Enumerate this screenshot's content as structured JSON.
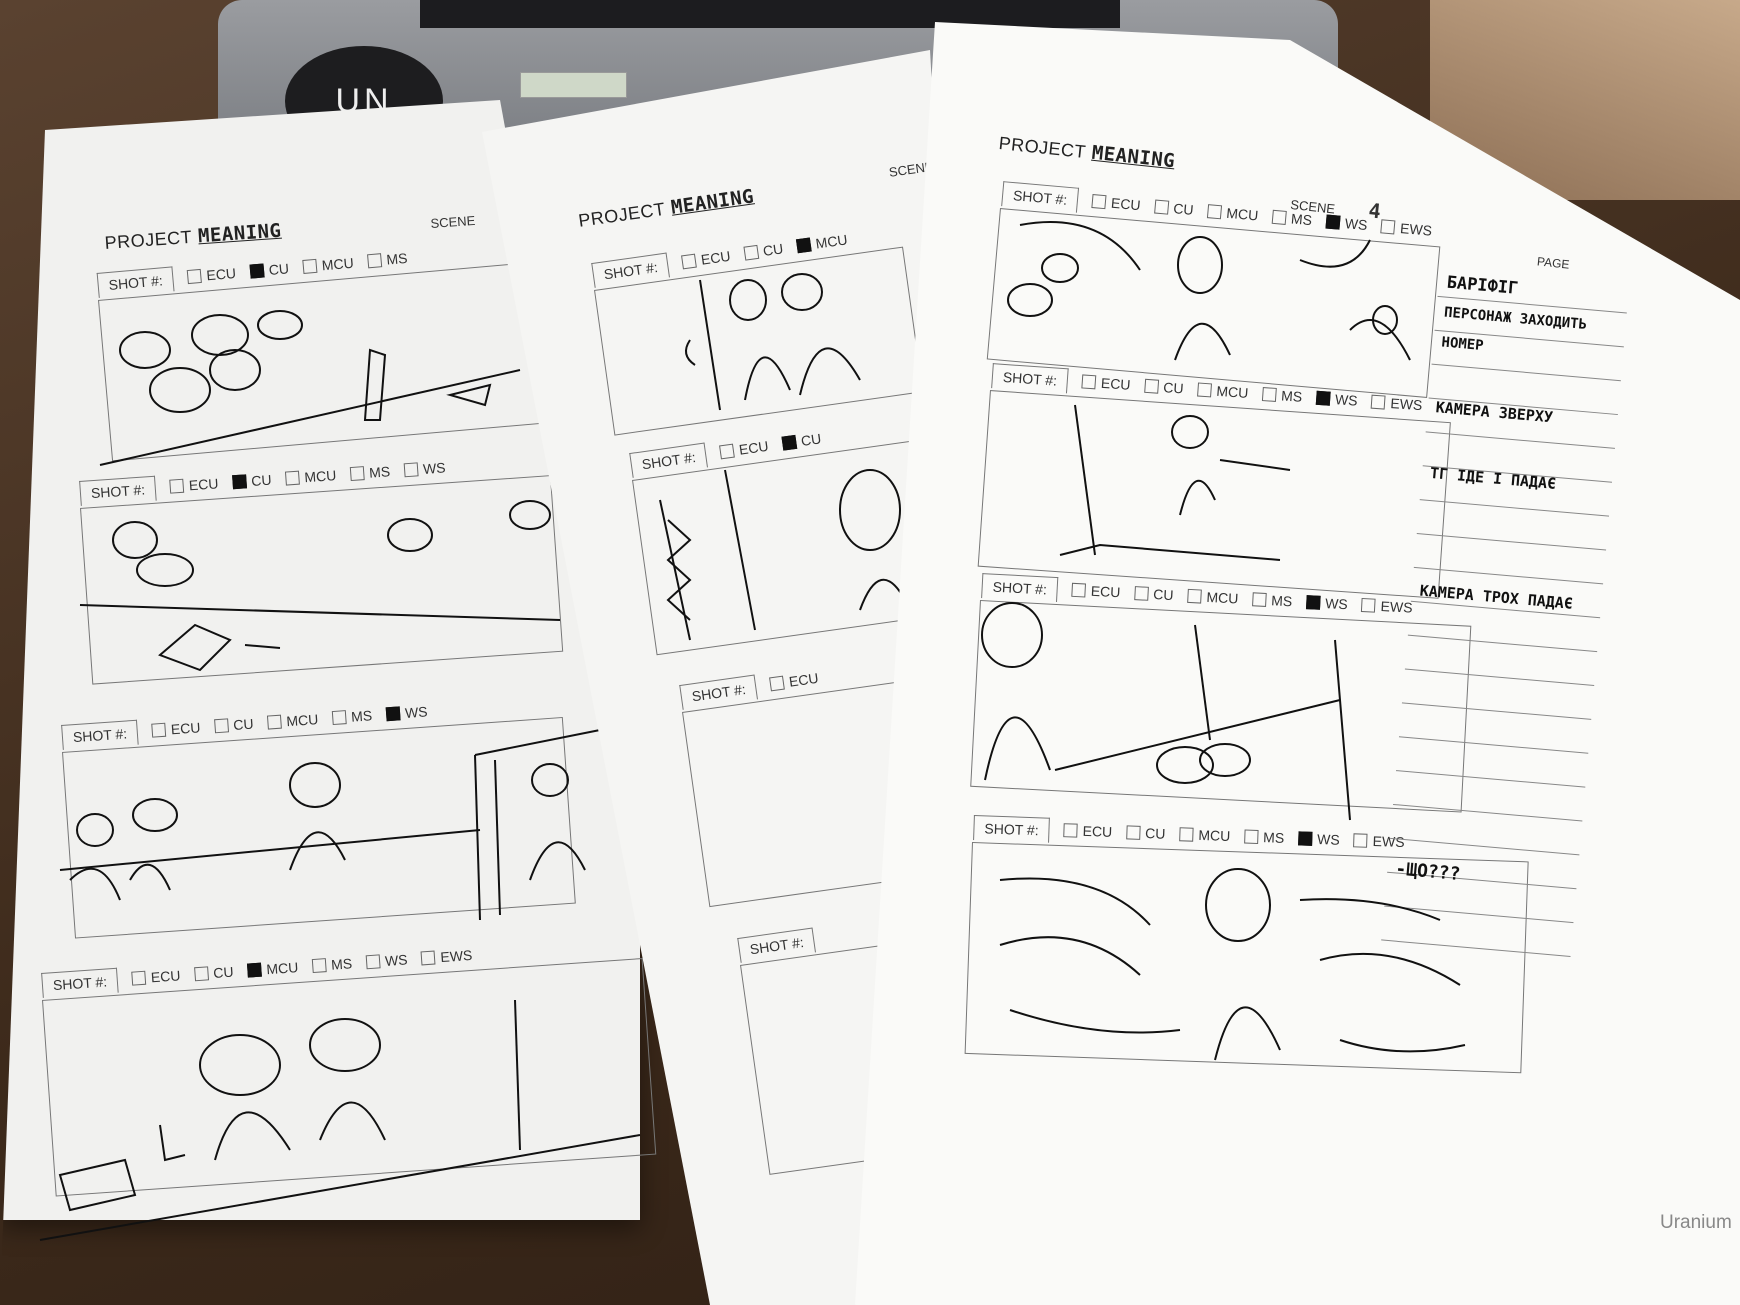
{
  "labels": {
    "project": "PROJECT",
    "project_name": "MEANING",
    "scene": "SCENE",
    "scene_number": "4",
    "page": "PAGE",
    "shot": "SHOT #:",
    "brand": "Uranium",
    "sticker": "UN"
  },
  "shot_types": [
    "ECU",
    "CU",
    "MCU",
    "MS",
    "WS",
    "EWS"
  ],
  "sheets": [
    {
      "frames": [
        {
          "checked": "CU"
        },
        {
          "checked": "CU"
        },
        {
          "checked": "WS"
        },
        {
          "checked": "MCU"
        }
      ]
    },
    {
      "frames": [
        {
          "checked": "MCU"
        },
        {
          "checked": "CU"
        },
        {
          "checked": ""
        },
        {
          "checked": ""
        }
      ]
    },
    {
      "frames": [
        {
          "checked": "WS"
        },
        {
          "checked": "WS"
        },
        {
          "checked": "WS"
        },
        {
          "checked": "WS"
        }
      ]
    }
  ],
  "notes": [
    "БАРІФІГ",
    "ПЕРСОНАЖ ЗАХОДИТЬ",
    "НОМЕР",
    "КАМЕРА ЗВЕРХУ",
    "ТГ ІДЕ І ПАДАЄ",
    "КАМЕРА ТРОХ ПАДАЄ",
    "-ЩО???"
  ]
}
